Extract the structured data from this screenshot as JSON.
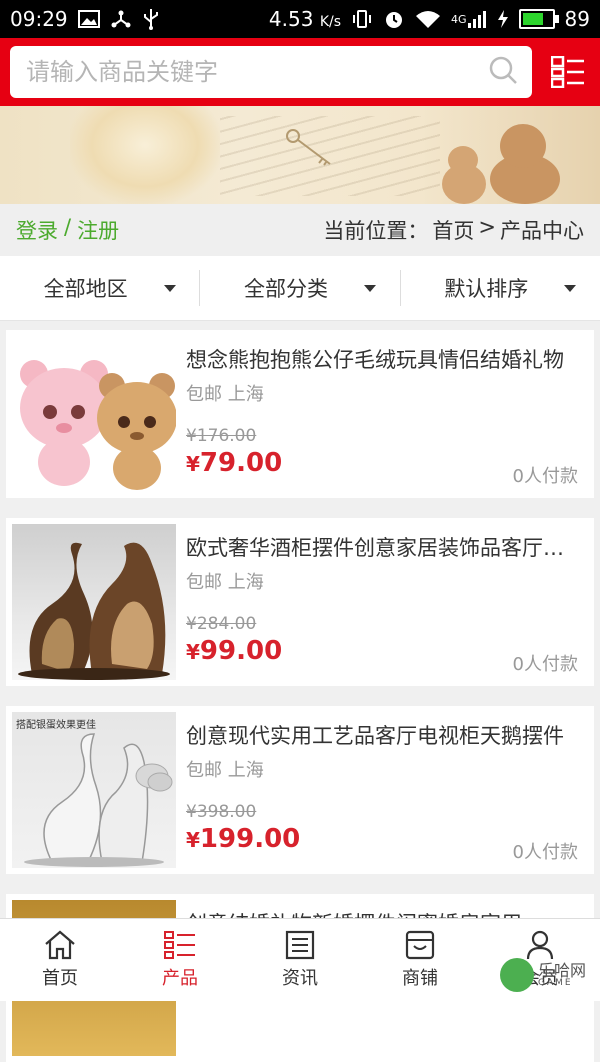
{
  "status_bar": {
    "time": "09:29",
    "speed": "4.53",
    "speed_unit": "K/s",
    "network": "4G",
    "battery": "89",
    "battery_level": 0.89
  },
  "search": {
    "placeholder": "请输入商品关键字"
  },
  "login": {
    "login_label": "登录",
    "separator": "/",
    "register_label": "注册"
  },
  "breadcrumb": {
    "prefix": "当前位置：",
    "home": "首页",
    "arrow": ">",
    "current": "产品中心"
  },
  "filters": [
    {
      "label": "全部地区"
    },
    {
      "label": "全部分类"
    },
    {
      "label": "默认排序"
    }
  ],
  "products": [
    {
      "title": "想念熊抱抱熊公仔毛绒玩具情侣结婚礼物",
      "shipping": "包邮",
      "location": "上海",
      "old_price": "¥176.00",
      "currency": "¥",
      "price": "79.00",
      "sold": "0人付款"
    },
    {
      "title": "欧式奢华酒柜摆件创意家居装饰品客厅摆设",
      "shipping": "包邮",
      "location": "上海",
      "old_price": "¥284.00",
      "currency": "¥",
      "price": "99.00",
      "sold": "0人付款"
    },
    {
      "title": "创意现代实用工艺品客厅电视柜天鹅摆件",
      "shipping": "包邮",
      "location": "上海",
      "old_price": "¥398.00",
      "currency": "¥",
      "price": "199.00",
      "sold": "0人付款",
      "image_caption": "搭配银蛋效果更佳"
    },
    {
      "title": "创意结婚礼物新婚摆件闺蜜婚房家用"
    }
  ],
  "tabs": [
    {
      "label": "首页",
      "icon": "home-icon"
    },
    {
      "label": "产品",
      "icon": "list-icon",
      "active": true
    },
    {
      "label": "资讯",
      "icon": "news-icon"
    },
    {
      "label": "商铺",
      "icon": "store-icon"
    },
    {
      "label": "会员",
      "icon": "user-icon"
    }
  ],
  "watermark": {
    "text": "乐哈网",
    "sub": "GAME"
  },
  "colors": {
    "brand_red": "#e60012",
    "price_red": "#d7222c",
    "link_green": "#4caa2e"
  }
}
